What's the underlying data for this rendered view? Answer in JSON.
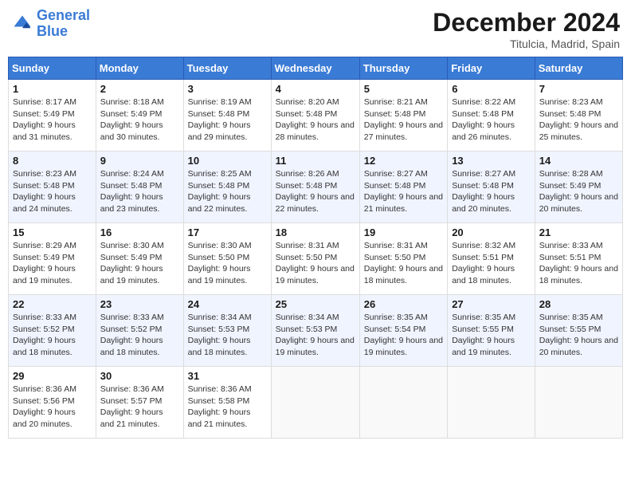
{
  "header": {
    "logo_line1": "General",
    "logo_line2": "Blue",
    "month": "December 2024",
    "location": "Titulcia, Madrid, Spain"
  },
  "weekdays": [
    "Sunday",
    "Monday",
    "Tuesday",
    "Wednesday",
    "Thursday",
    "Friday",
    "Saturday"
  ],
  "rows": [
    [
      {
        "day": "1",
        "sr": "8:17 AM",
        "ss": "5:49 PM",
        "dl": "9 hours and 31 minutes."
      },
      {
        "day": "2",
        "sr": "8:18 AM",
        "ss": "5:49 PM",
        "dl": "9 hours and 30 minutes."
      },
      {
        "day": "3",
        "sr": "8:19 AM",
        "ss": "5:48 PM",
        "dl": "9 hours and 29 minutes."
      },
      {
        "day": "4",
        "sr": "8:20 AM",
        "ss": "5:48 PM",
        "dl": "9 hours and 28 minutes."
      },
      {
        "day": "5",
        "sr": "8:21 AM",
        "ss": "5:48 PM",
        "dl": "9 hours and 27 minutes."
      },
      {
        "day": "6",
        "sr": "8:22 AM",
        "ss": "5:48 PM",
        "dl": "9 hours and 26 minutes."
      },
      {
        "day": "7",
        "sr": "8:23 AM",
        "ss": "5:48 PM",
        "dl": "9 hours and 25 minutes."
      }
    ],
    [
      {
        "day": "8",
        "sr": "8:23 AM",
        "ss": "5:48 PM",
        "dl": "9 hours and 24 minutes."
      },
      {
        "day": "9",
        "sr": "8:24 AM",
        "ss": "5:48 PM",
        "dl": "9 hours and 23 minutes."
      },
      {
        "day": "10",
        "sr": "8:25 AM",
        "ss": "5:48 PM",
        "dl": "9 hours and 22 minutes."
      },
      {
        "day": "11",
        "sr": "8:26 AM",
        "ss": "5:48 PM",
        "dl": "9 hours and 22 minutes."
      },
      {
        "day": "12",
        "sr": "8:27 AM",
        "ss": "5:48 PM",
        "dl": "9 hours and 21 minutes."
      },
      {
        "day": "13",
        "sr": "8:27 AM",
        "ss": "5:48 PM",
        "dl": "9 hours and 20 minutes."
      },
      {
        "day": "14",
        "sr": "8:28 AM",
        "ss": "5:49 PM",
        "dl": "9 hours and 20 minutes."
      }
    ],
    [
      {
        "day": "15",
        "sr": "8:29 AM",
        "ss": "5:49 PM",
        "dl": "9 hours and 19 minutes."
      },
      {
        "day": "16",
        "sr": "8:30 AM",
        "ss": "5:49 PM",
        "dl": "9 hours and 19 minutes."
      },
      {
        "day": "17",
        "sr": "8:30 AM",
        "ss": "5:50 PM",
        "dl": "9 hours and 19 minutes."
      },
      {
        "day": "18",
        "sr": "8:31 AM",
        "ss": "5:50 PM",
        "dl": "9 hours and 19 minutes."
      },
      {
        "day": "19",
        "sr": "8:31 AM",
        "ss": "5:50 PM",
        "dl": "9 hours and 18 minutes."
      },
      {
        "day": "20",
        "sr": "8:32 AM",
        "ss": "5:51 PM",
        "dl": "9 hours and 18 minutes."
      },
      {
        "day": "21",
        "sr": "8:33 AM",
        "ss": "5:51 PM",
        "dl": "9 hours and 18 minutes."
      }
    ],
    [
      {
        "day": "22",
        "sr": "8:33 AM",
        "ss": "5:52 PM",
        "dl": "9 hours and 18 minutes."
      },
      {
        "day": "23",
        "sr": "8:33 AM",
        "ss": "5:52 PM",
        "dl": "9 hours and 18 minutes."
      },
      {
        "day": "24",
        "sr": "8:34 AM",
        "ss": "5:53 PM",
        "dl": "9 hours and 18 minutes."
      },
      {
        "day": "25",
        "sr": "8:34 AM",
        "ss": "5:53 PM",
        "dl": "9 hours and 19 minutes."
      },
      {
        "day": "26",
        "sr": "8:35 AM",
        "ss": "5:54 PM",
        "dl": "9 hours and 19 minutes."
      },
      {
        "day": "27",
        "sr": "8:35 AM",
        "ss": "5:55 PM",
        "dl": "9 hours and 19 minutes."
      },
      {
        "day": "28",
        "sr": "8:35 AM",
        "ss": "5:55 PM",
        "dl": "9 hours and 20 minutes."
      }
    ],
    [
      {
        "day": "29",
        "sr": "8:36 AM",
        "ss": "5:56 PM",
        "dl": "9 hours and 20 minutes."
      },
      {
        "day": "30",
        "sr": "8:36 AM",
        "ss": "5:57 PM",
        "dl": "9 hours and 21 minutes."
      },
      {
        "day": "31",
        "sr": "8:36 AM",
        "ss": "5:58 PM",
        "dl": "9 hours and 21 minutes."
      },
      null,
      null,
      null,
      null
    ]
  ]
}
